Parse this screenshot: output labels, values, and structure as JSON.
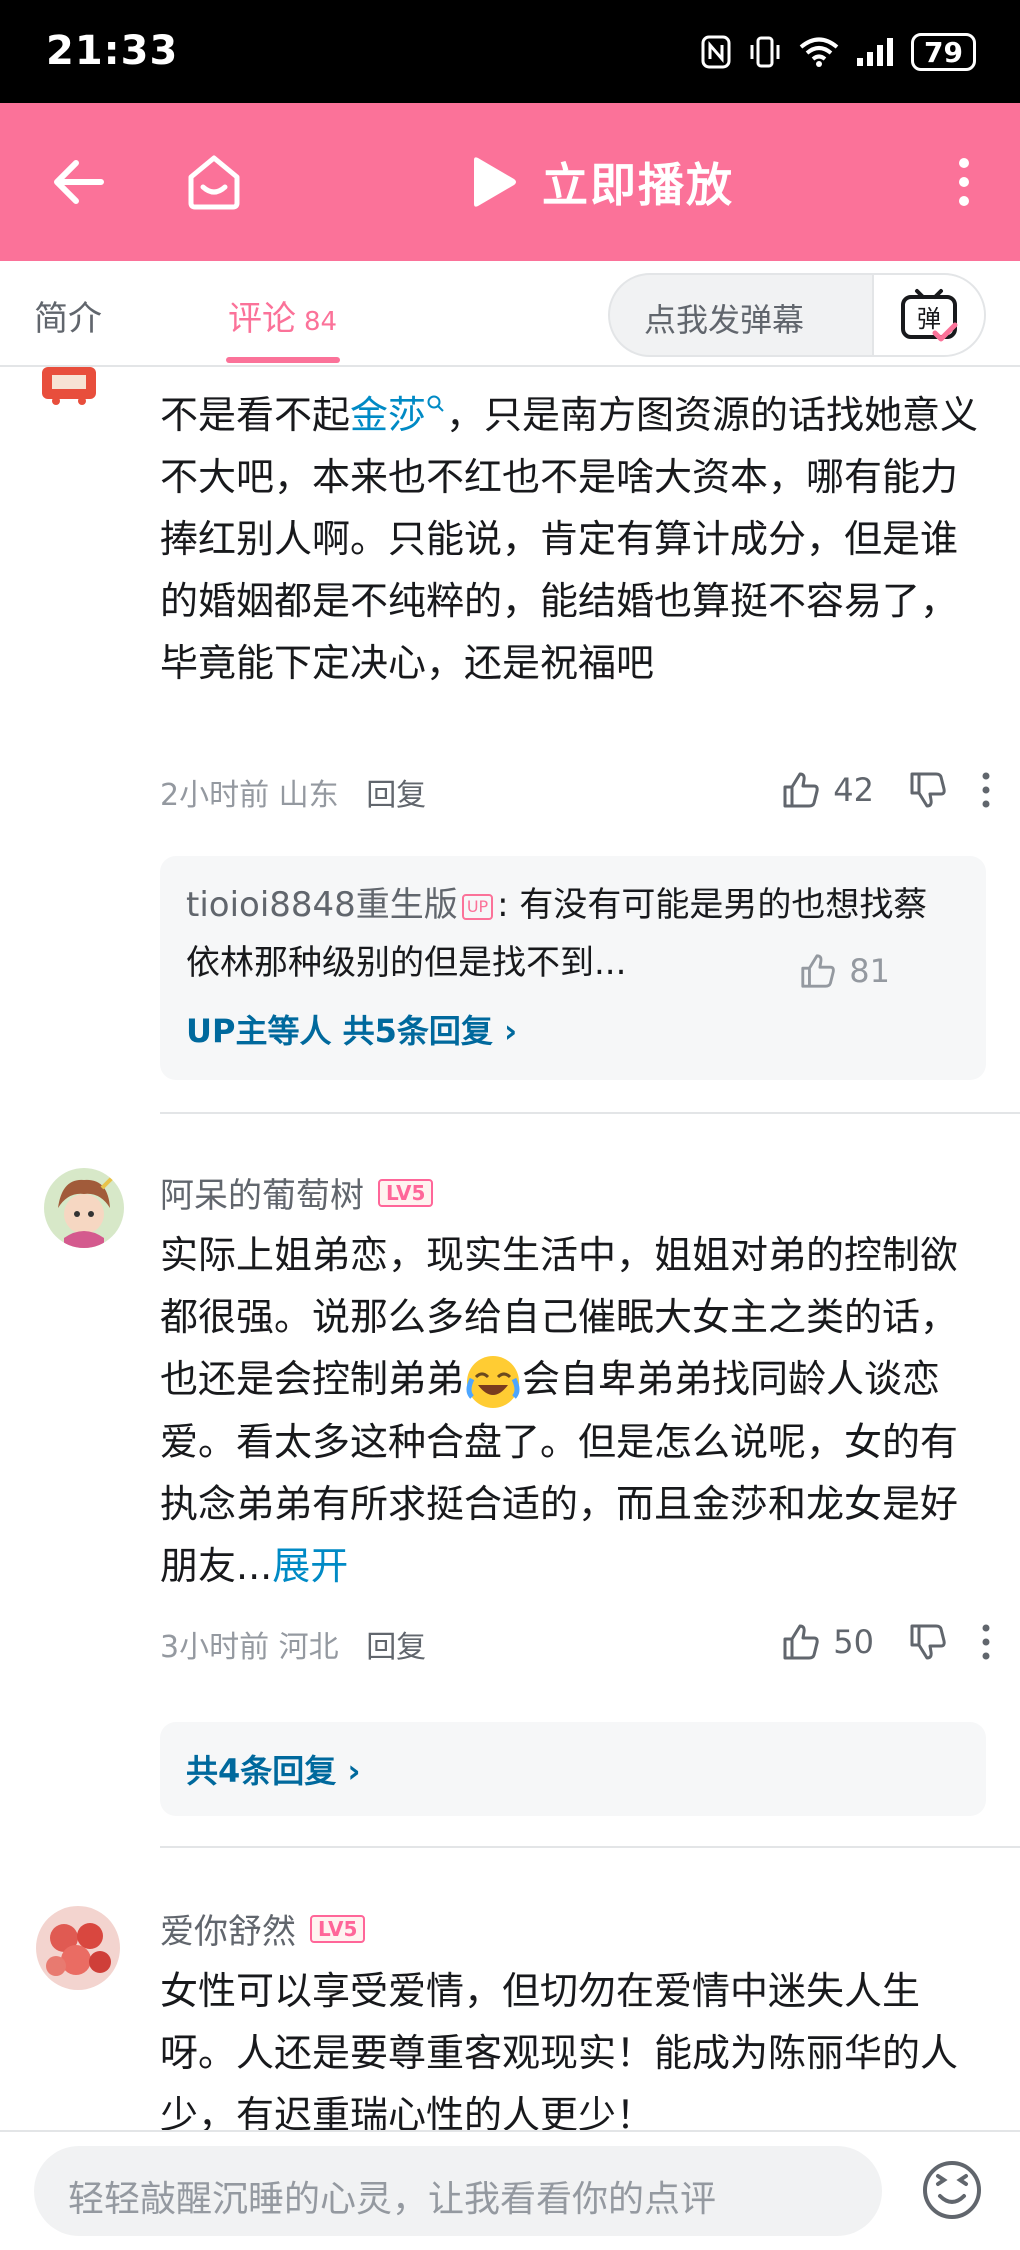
{
  "status_bar": {
    "time": "21:33",
    "battery": "79"
  },
  "app_bar": {
    "play_label": "立即播放"
  },
  "tabs": {
    "intro": "简介",
    "comments": "评论",
    "comments_count": "84",
    "danmaku_placeholder": "点我发弹幕",
    "danmaku_icon_char": "弹"
  },
  "comments": [
    {
      "body_pre": "不是看不起",
      "body_link": "金莎",
      "body_post": "，只是南方图资源的话找她意义不大吧，本来也不红也不是啥大资本，哪有能力捧红别人啊。只能说，肯定有算计成分，但是谁的婚姻都是不纯粹的，能结婚也算挺不容易了，毕竟能下定决心，还是祝福吧",
      "time": "2小时前",
      "location": "山东",
      "reply_label": "回复",
      "likes": "42",
      "reply_preview": {
        "user": "tioioi8848重生版",
        "badge": "UP",
        "text": ": 有没有可能是男的也想找蔡依林那种级别的但是找不到...",
        "likes": "81",
        "more": "UP主等人 共5条回复 ›"
      }
    },
    {
      "username": "阿呆的葡萄树",
      "level": "LV5",
      "body_pre": "实际上姐弟恋，现实生活中，姐姐对弟的控制欲都很强。说那么多给自己催眠大女主之类的话，也还是会控制弟弟",
      "body_post": "会自卑弟弟找同龄人谈恋爱。看太多这种合盘了。但是怎么说呢，女的有执念弟弟有所求挺合适的，而且金莎和龙女是好朋友...",
      "expand": "展开",
      "time": "3小时前",
      "location": "河北",
      "reply_label": "回复",
      "likes": "50",
      "more": "共4条回复 ›"
    },
    {
      "username": "爱你舒然",
      "level": "LV5",
      "body": "女性可以享受爱情，但切勿在爱情中迷失人生呀。人还是要尊重客观现实！能成为陈丽华的人少，有迟重瑞心性的人更少！"
    }
  ],
  "bottom": {
    "placeholder": "轻轻敲醒沉睡的心灵，让我看看你的点评"
  }
}
